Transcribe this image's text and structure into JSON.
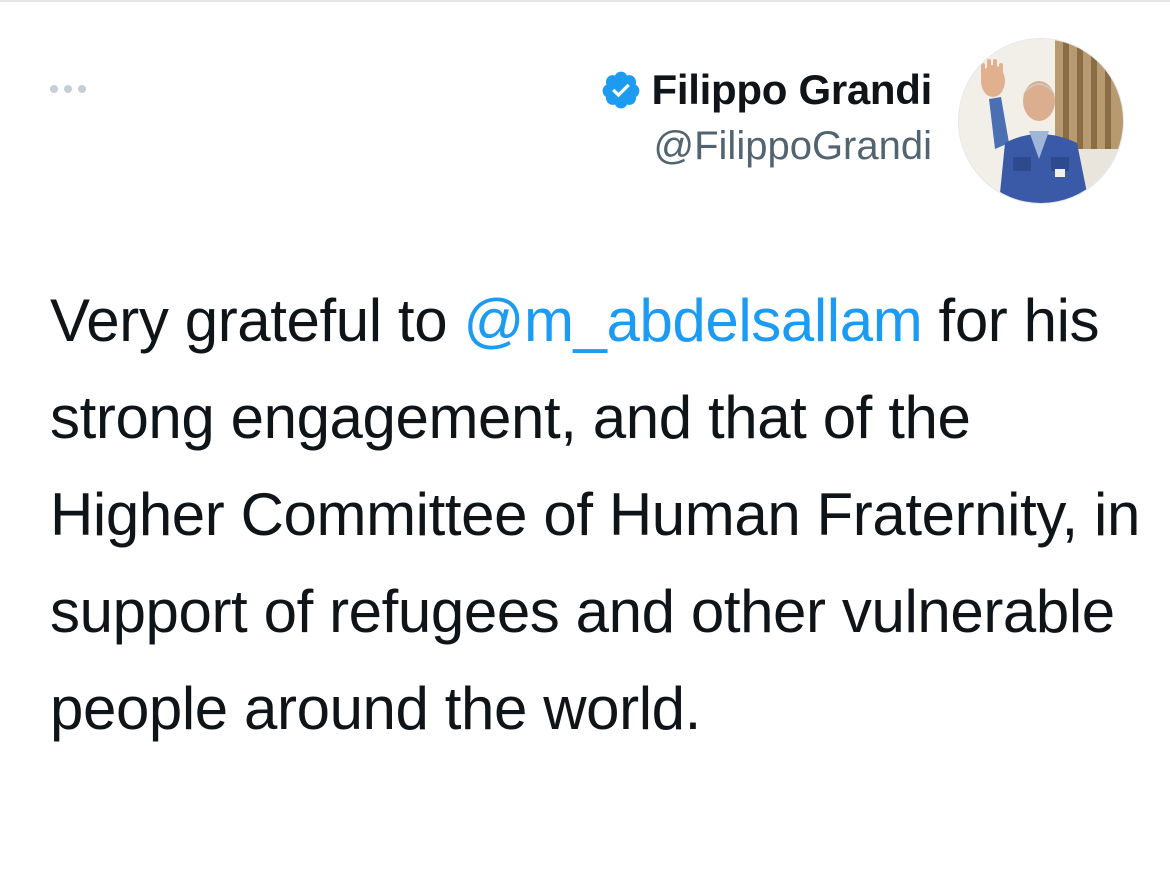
{
  "tweet": {
    "author": {
      "display_name": "Filippo Grandi",
      "handle": "@FilippoGrandi",
      "verified_icon": "verified-badge-icon",
      "avatar_icon": "profile-photo-avatar"
    },
    "more_icon": "more-options-icon",
    "text": {
      "before_mention": "Very grateful to ",
      "mention": "@m_abdelsallam",
      "after_mention": " for his strong engagement, and that of the Higher Committee of Human Fraternity, in support of refugees and other vulnerable people around the world."
    }
  },
  "colors": {
    "mention": "#1d9bf0",
    "verified": "#1d9bf0",
    "text": "#0f1419",
    "secondary_text": "#536471",
    "more_dots": "#c4cfd6"
  }
}
